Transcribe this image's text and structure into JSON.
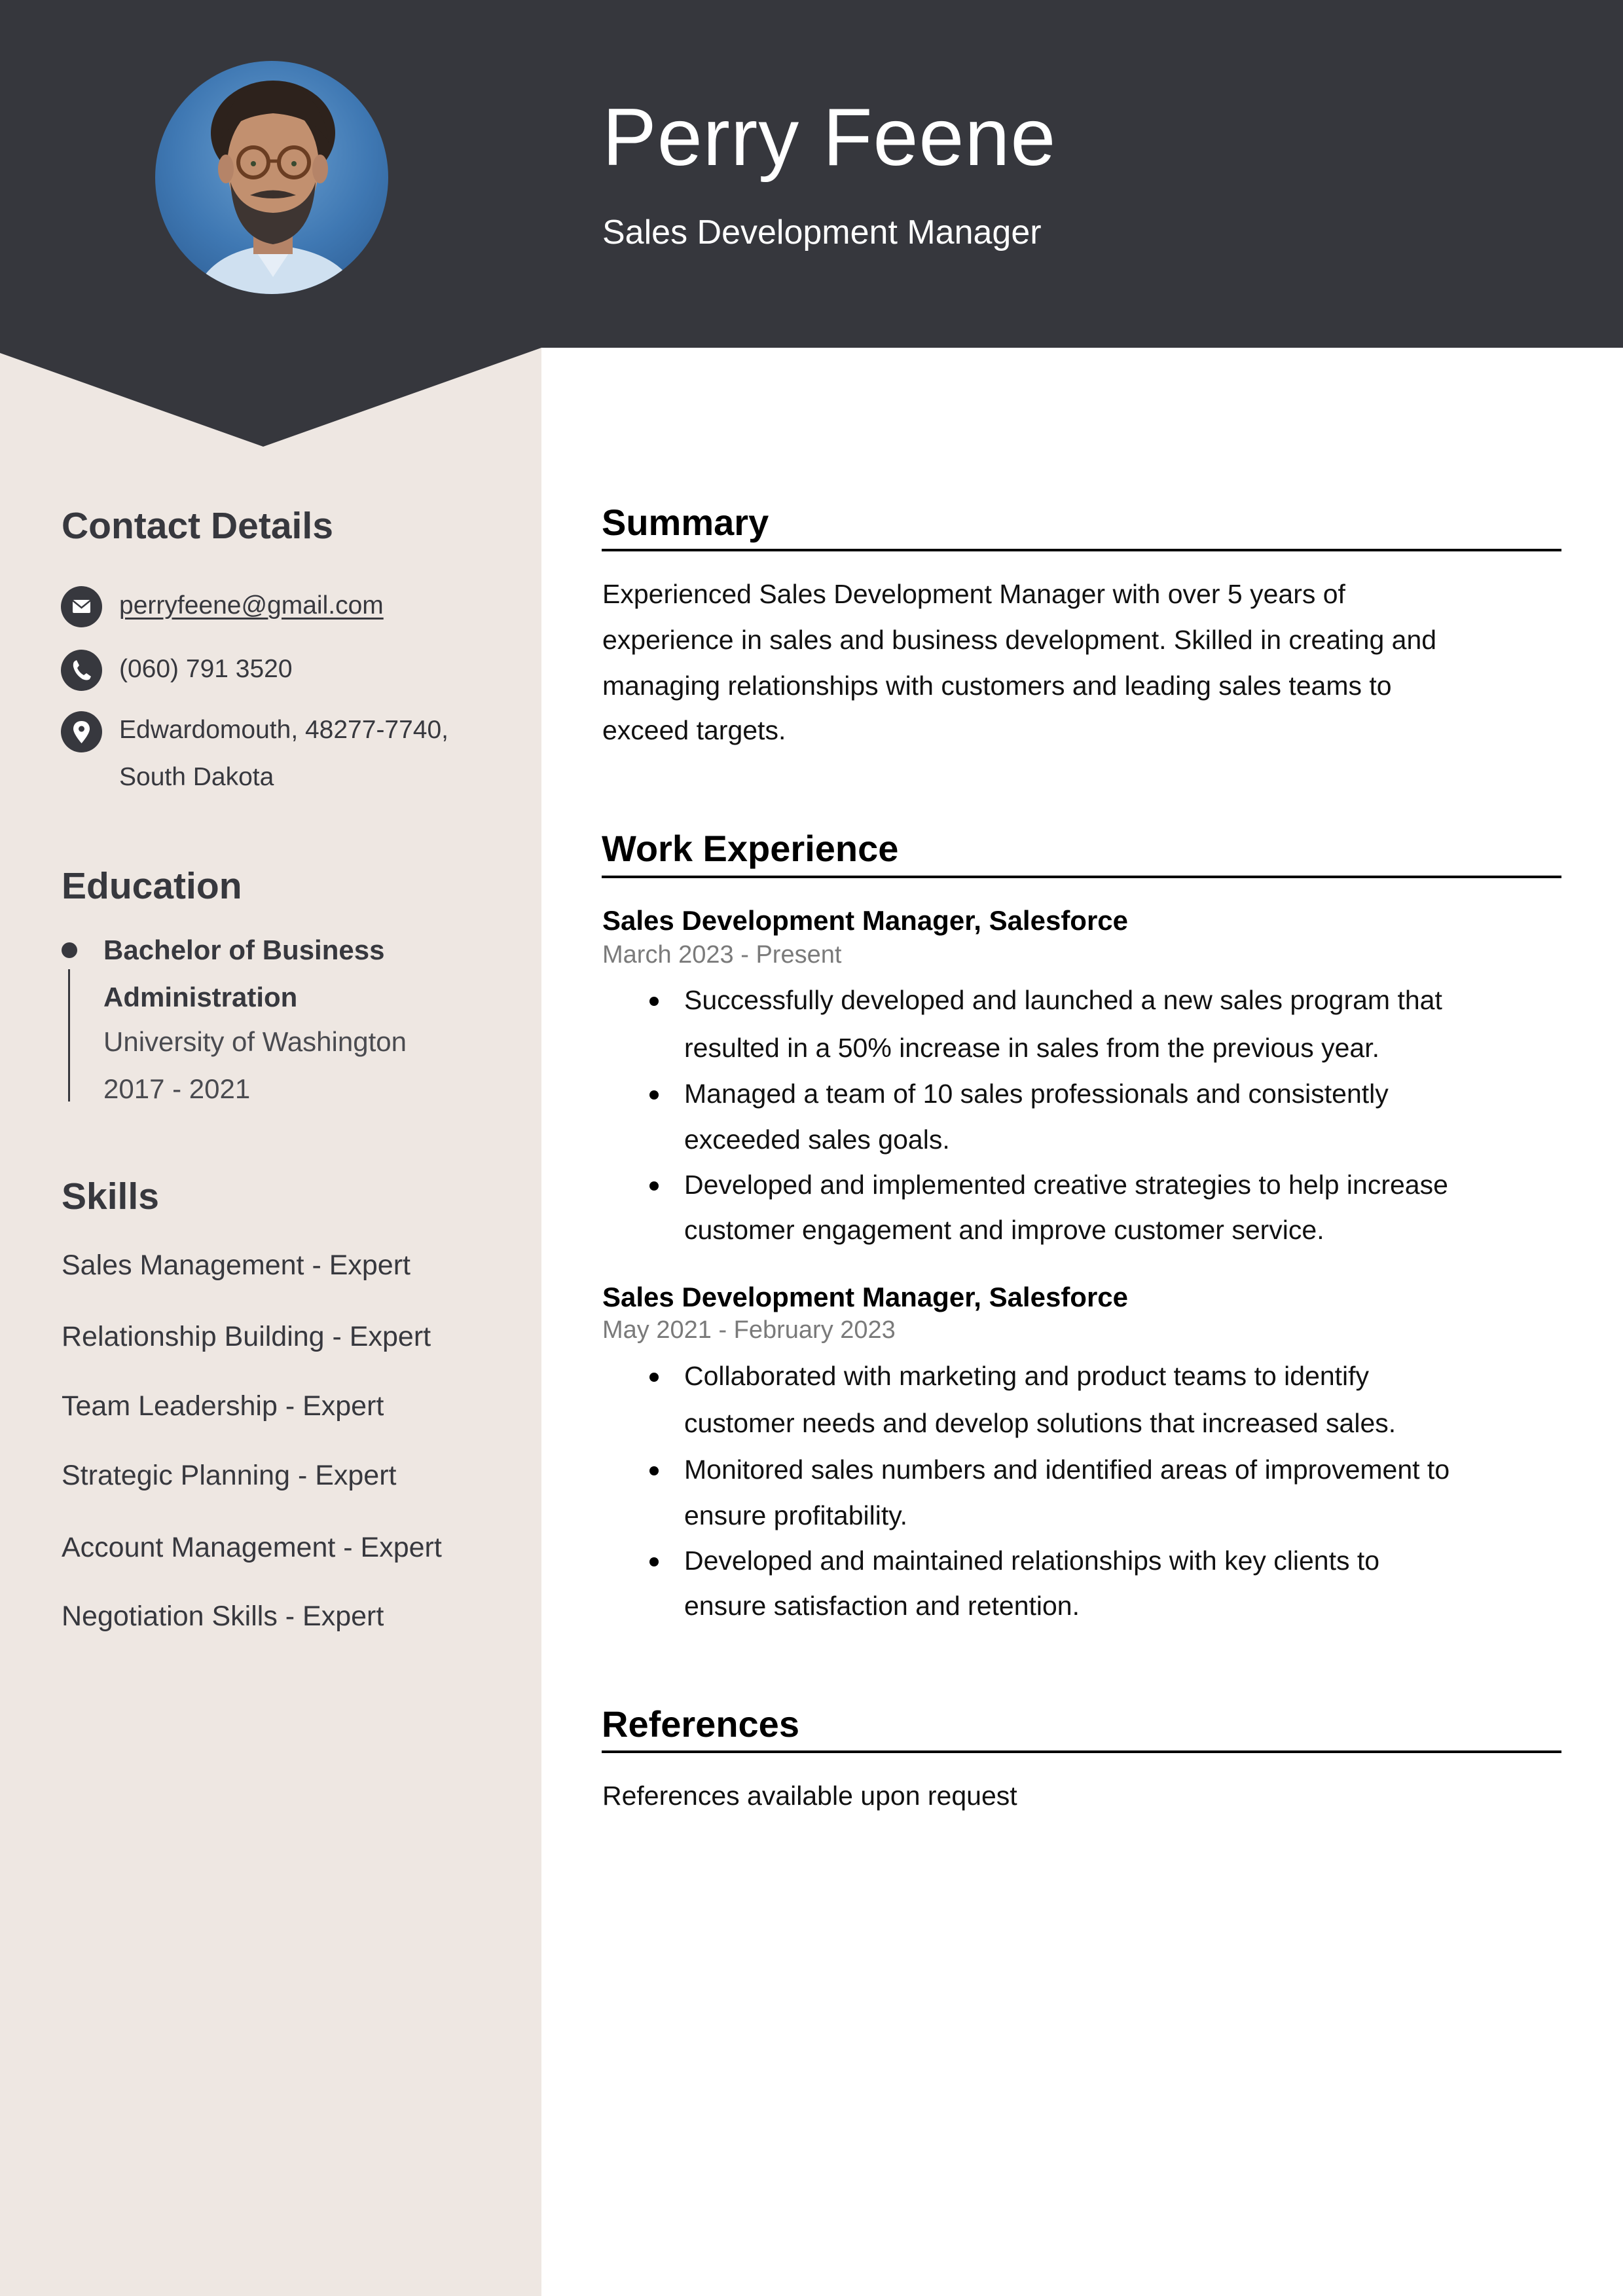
{
  "colors": {
    "header_bg": "#36373d",
    "sidebar_bg": "#eee7e2",
    "sidebar_text": "#37383e",
    "date_text": "#7a7a7a",
    "main_text": "#111111"
  },
  "header": {
    "name": "Perry Feene",
    "title": "Sales Development Manager",
    "photo": "profile-photo"
  },
  "sidebar": {
    "contact": {
      "heading": "Contact Details",
      "email": {
        "icon": "envelope-icon",
        "value": "perryfeene@gmail.com"
      },
      "phone": {
        "icon": "phone-icon",
        "value": "(060) 791 3520"
      },
      "address": {
        "icon": "location-pin-icon",
        "lines": [
          "Edwardomouth, 48277-7740,",
          "South Dakota"
        ]
      }
    },
    "education": {
      "heading": "Education",
      "items": [
        {
          "degree_lines": [
            "Bachelor of Business",
            "Administration"
          ],
          "school": "University of Washington",
          "years": "2017 - 2021"
        }
      ]
    },
    "skills": {
      "heading": "Skills",
      "items": [
        "Sales Management - Expert",
        "Relationship Building - Expert",
        "Team Leadership - Expert",
        "Strategic Planning - Expert",
        "Account Management - Expert",
        "Negotiation Skills - Expert"
      ]
    }
  },
  "main": {
    "summary": {
      "heading": "Summary",
      "lines": [
        "Experienced Sales Development Manager with over 5 years of",
        "experience in sales and business development. Skilled in creating and",
        "managing relationships with customers and leading sales teams to",
        "exceed targets."
      ]
    },
    "work": {
      "heading": "Work Experience",
      "jobs": [
        {
          "title": "Sales Development Manager, Salesforce",
          "dates": "March 2023 - Present",
          "bullets": [
            [
              "Successfully developed and launched a new sales program that",
              "resulted in a 50% increase in sales from the previous year."
            ],
            [
              "Managed a team of 10 sales professionals and consistently",
              "exceeded sales goals."
            ],
            [
              "Developed and implemented creative strategies to help increase",
              "customer engagement and improve customer service."
            ]
          ]
        },
        {
          "title": "Sales Development Manager, Salesforce",
          "dates": "May 2021 - February 2023",
          "bullets": [
            [
              "Collaborated with marketing and product teams to identify",
              "customer needs and develop solutions that increased sales."
            ],
            [
              "Monitored sales numbers and identified areas of improvement to",
              "ensure profitability."
            ],
            [
              "Developed and maintained relationships with key clients to",
              "ensure satisfaction and retention."
            ]
          ]
        }
      ]
    },
    "references": {
      "heading": "References",
      "text": "References available upon request"
    }
  }
}
